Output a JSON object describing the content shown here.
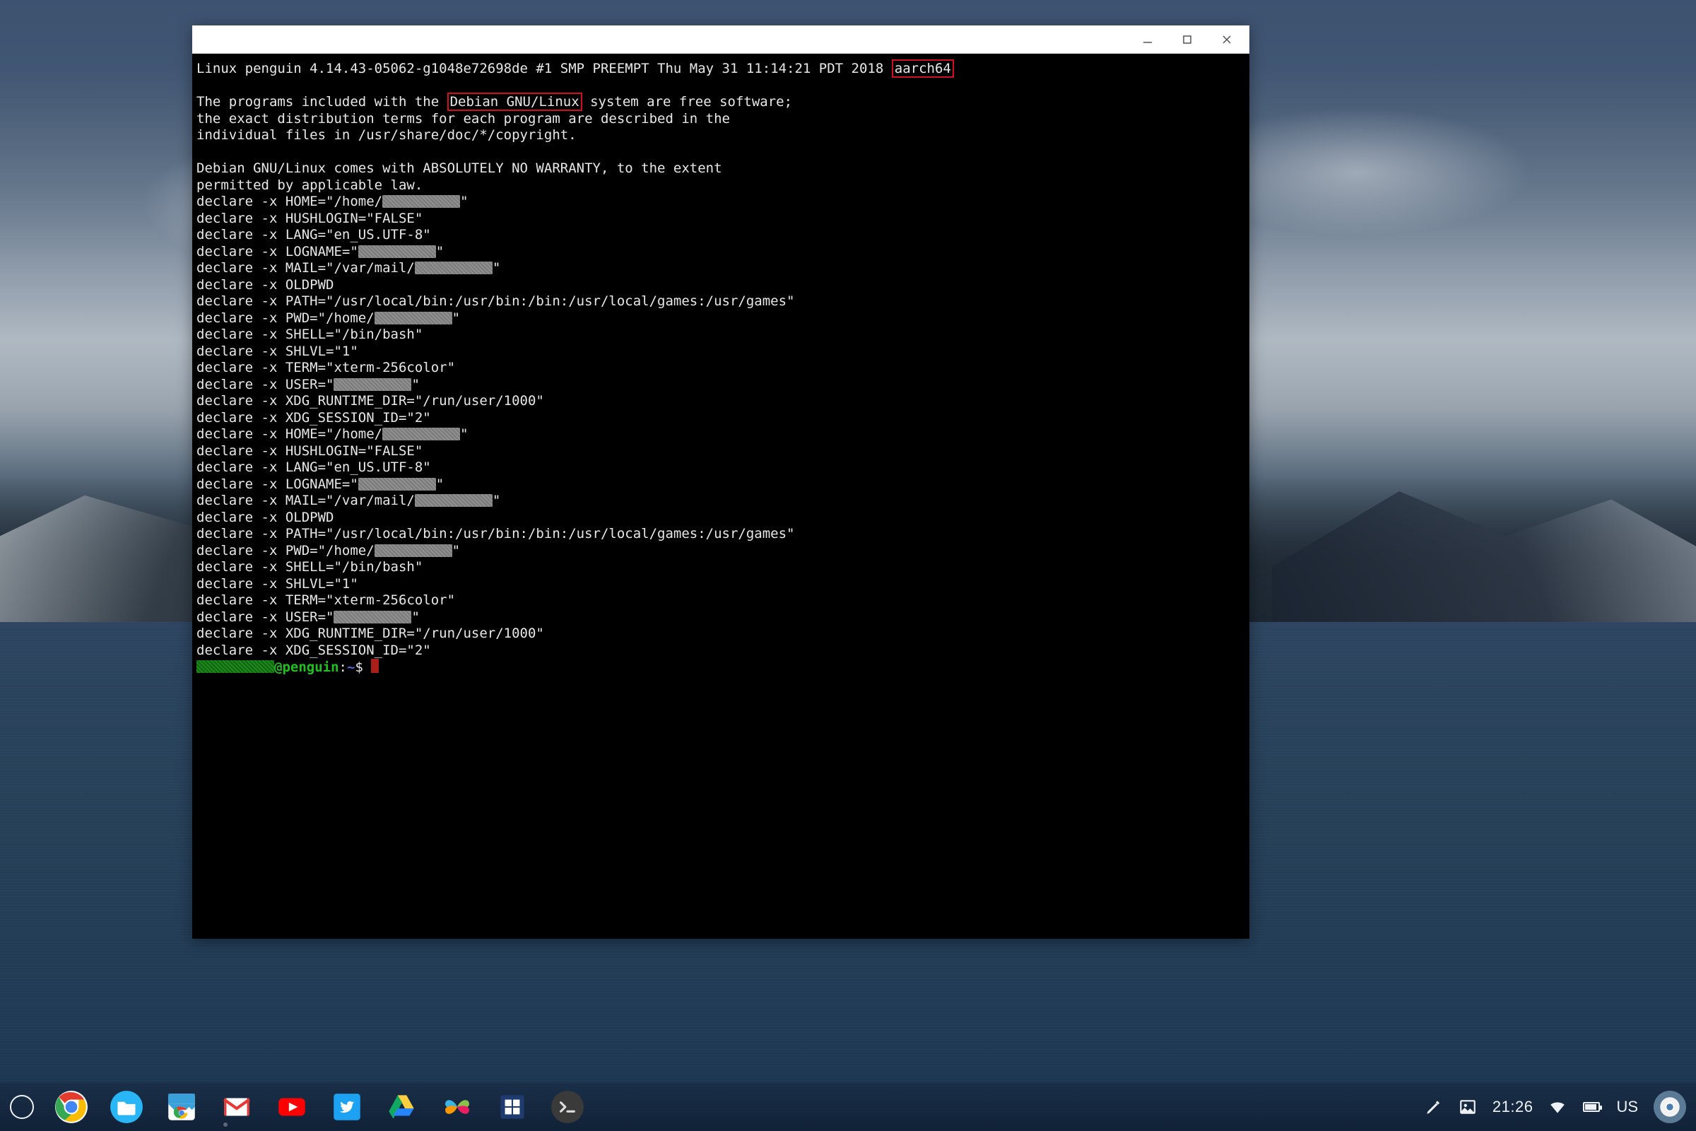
{
  "window": {
    "title": "",
    "controls": {
      "minimize": "–",
      "maximize": "▢",
      "close": "×"
    }
  },
  "terminal": {
    "uname_prefix": "Linux penguin 4.14.43-05062-g1048e72698de #1 SMP PREEMPT Thu May 31 11:14:21 PDT 2018 ",
    "arch": "aarch64",
    "motd1_pre": "The programs included with the ",
    "motd1_hl": "Debian GNU/Linux",
    "motd1_post": " system are free software;",
    "motd2": "the exact distribution terms for each program are described in the",
    "motd3": "individual files in /usr/share/doc/*/copyright.",
    "motd4": "Debian GNU/Linux comes with ABSOLUTELY NO WARRANTY, to the extent",
    "motd5": "permitted by applicable law.",
    "env": [
      {
        "pre": "declare -x HOME=\"/home/",
        "redact_w": 110,
        "post": "\""
      },
      {
        "pre": "declare -x HUSHLOGIN=\"FALSE\"",
        "redact_w": 0,
        "post": ""
      },
      {
        "pre": "declare -x LANG=\"en_US.UTF-8\"",
        "redact_w": 0,
        "post": ""
      },
      {
        "pre": "declare -x LOGNAME=\"",
        "redact_w": 110,
        "post": "\""
      },
      {
        "pre": "declare -x MAIL=\"/var/mail/",
        "redact_w": 110,
        "post": "\""
      },
      {
        "pre": "declare -x OLDPWD",
        "redact_w": 0,
        "post": ""
      },
      {
        "pre": "declare -x PATH=\"/usr/local/bin:/usr/bin:/bin:/usr/local/games:/usr/games\"",
        "redact_w": 0,
        "post": ""
      },
      {
        "pre": "declare -x PWD=\"/home/",
        "redact_w": 110,
        "post": "\""
      },
      {
        "pre": "declare -x SHELL=\"/bin/bash\"",
        "redact_w": 0,
        "post": ""
      },
      {
        "pre": "declare -x SHLVL=\"1\"",
        "redact_w": 0,
        "post": ""
      },
      {
        "pre": "declare -x TERM=\"xterm-256color\"",
        "redact_w": 0,
        "post": ""
      },
      {
        "pre": "declare -x USER=\"",
        "redact_w": 110,
        "post": "\""
      },
      {
        "pre": "declare -x XDG_RUNTIME_DIR=\"/run/user/1000\"",
        "redact_w": 0,
        "post": ""
      },
      {
        "pre": "declare -x XDG_SESSION_ID=\"2\"",
        "redact_w": 0,
        "post": ""
      },
      {
        "pre": "declare -x HOME=\"/home/",
        "redact_w": 110,
        "post": "\""
      },
      {
        "pre": "declare -x HUSHLOGIN=\"FALSE\"",
        "redact_w": 0,
        "post": ""
      },
      {
        "pre": "declare -x LANG=\"en_US.UTF-8\"",
        "redact_w": 0,
        "post": ""
      },
      {
        "pre": "declare -x LOGNAME=\"",
        "redact_w": 110,
        "post": "\""
      },
      {
        "pre": "declare -x MAIL=\"/var/mail/",
        "redact_w": 110,
        "post": "\""
      },
      {
        "pre": "declare -x OLDPWD",
        "redact_w": 0,
        "post": ""
      },
      {
        "pre": "declare -x PATH=\"/usr/local/bin:/usr/bin:/bin:/usr/local/games:/usr/games\"",
        "redact_w": 0,
        "post": ""
      },
      {
        "pre": "declare -x PWD=\"/home/",
        "redact_w": 110,
        "post": "\""
      },
      {
        "pre": "declare -x SHELL=\"/bin/bash\"",
        "redact_w": 0,
        "post": ""
      },
      {
        "pre": "declare -x SHLVL=\"1\"",
        "redact_w": 0,
        "post": ""
      },
      {
        "pre": "declare -x TERM=\"xterm-256color\"",
        "redact_w": 0,
        "post": ""
      },
      {
        "pre": "declare -x USER=\"",
        "redact_w": 110,
        "post": "\""
      },
      {
        "pre": "declare -x XDG_RUNTIME_DIR=\"/run/user/1000\"",
        "redact_w": 0,
        "post": ""
      },
      {
        "pre": "declare -x XDG_SESSION_ID=\"2\"",
        "redact_w": 0,
        "post": ""
      }
    ],
    "prompt": {
      "user_redact_w": 110,
      "at_host": "@penguin",
      "colon": ":",
      "path": "~",
      "dollar": "$ "
    }
  },
  "shelf": {
    "apps": [
      {
        "name": "chrome"
      },
      {
        "name": "files"
      },
      {
        "name": "webstore"
      },
      {
        "name": "gmail"
      },
      {
        "name": "youtube"
      },
      {
        "name": "twitter"
      },
      {
        "name": "drive"
      },
      {
        "name": "butterfly"
      },
      {
        "name": "windows"
      },
      {
        "name": "terminal"
      }
    ]
  },
  "status": {
    "time": "21:26",
    "locale": "US"
  }
}
